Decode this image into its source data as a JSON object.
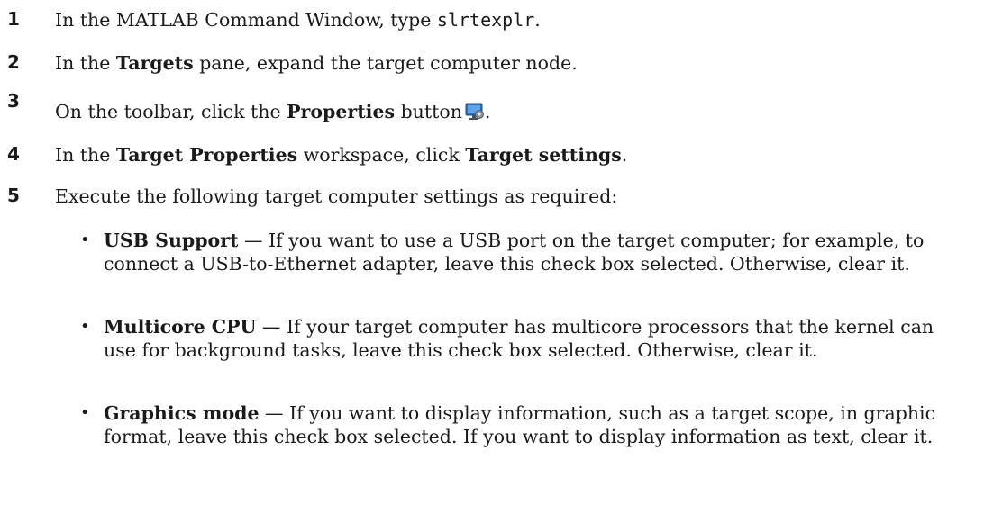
{
  "steps": [
    {
      "number": "1",
      "text_before": "In the MATLAB Command Window, type ",
      "code": "slrtexplr",
      "text_after": "."
    },
    {
      "number": "2",
      "text_before": "In the ",
      "bold": "Targets",
      "text_after": " pane, expand the target computer node."
    },
    {
      "number": "3",
      "text_before": "On the toolbar, click the ",
      "bold": "Properties",
      "text_after": " button",
      "icon": "properties-icon",
      "text_end": "."
    },
    {
      "number": "4",
      "text_before": "In the ",
      "bold": "Target Properties",
      "text_middle": " workspace, click ",
      "bold2": "Target settings",
      "text_after": "."
    },
    {
      "number": "5",
      "text": "Execute the following target computer settings as required:"
    }
  ],
  "bullets": [
    {
      "bullet_char": "•",
      "title": "USB Support",
      "dash": " — ",
      "text": "If you want to use a USB port on the target computer; for example, to connect a USB-to-Ethernet adapter, leave this check box selected. Otherwise, clear it."
    },
    {
      "bullet_char": "•",
      "title": "Multicore CPU",
      "dash": " — ",
      "text": "If your target computer has multicore processors that the kernel can use for background tasks, leave this check box selected. Otherwise, clear it."
    },
    {
      "bullet_char": "•",
      "title": "Graphics mode",
      "dash": " — ",
      "text": "If you want to display information, such as a target scope, in graphic format, leave this check box selected. If you want to display information as text, clear it."
    }
  ],
  "colors": {
    "text": "#1a1a1a",
    "icon_monitor": "#2a6fb5",
    "icon_gear": "#8a8f96"
  }
}
